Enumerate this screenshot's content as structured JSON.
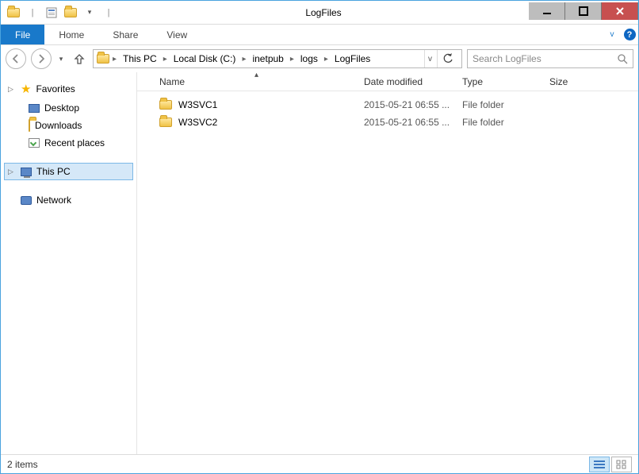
{
  "window": {
    "title": "LogFiles"
  },
  "ribbon": {
    "file": "File",
    "tabs": [
      "Home",
      "Share",
      "View"
    ]
  },
  "breadcrumb": {
    "items": [
      "This PC",
      "Local Disk (C:)",
      "inetpub",
      "logs",
      "LogFiles"
    ]
  },
  "search": {
    "placeholder": "Search LogFiles"
  },
  "sidebar": {
    "favorites": {
      "label": "Favorites",
      "items": [
        {
          "label": "Desktop"
        },
        {
          "label": "Downloads"
        },
        {
          "label": "Recent places"
        }
      ]
    },
    "thispc": {
      "label": "This PC"
    },
    "network": {
      "label": "Network"
    }
  },
  "columns": {
    "name": "Name",
    "date": "Date modified",
    "type": "Type",
    "size": "Size"
  },
  "rows": [
    {
      "name": "W3SVC1",
      "date": "2015-05-21 06:55 ...",
      "type": "File folder",
      "size": ""
    },
    {
      "name": "W3SVC2",
      "date": "2015-05-21 06:55 ...",
      "type": "File folder",
      "size": ""
    }
  ],
  "status": {
    "count": "2 items"
  }
}
